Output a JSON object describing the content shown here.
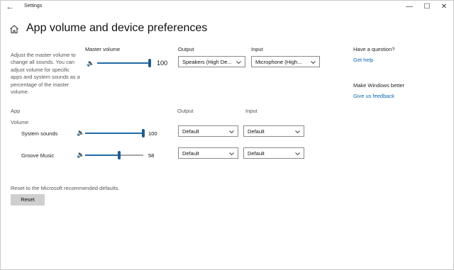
{
  "window": {
    "title": "Settings",
    "minimize_glyph": "—",
    "maximize_glyph": "☐",
    "close_glyph": "✕",
    "back_glyph": "←"
  },
  "page": {
    "title": "App volume and device preferences",
    "description": "Adjust the master volume to change all sounds. You can adjust volume for specific apps and system sounds as a percentage of the master volume."
  },
  "master": {
    "label": "Master volume",
    "value": "100",
    "level": 1.0,
    "output_label": "Output",
    "output_value": "Speakers (High De...",
    "input_label": "Input",
    "input_value": "Microphone (High..."
  },
  "apps": {
    "header": "App",
    "volume_header": "Volume",
    "output_header": "Output",
    "input_header": "Input",
    "rows": [
      {
        "name": "System sounds",
        "value": "100",
        "level": 1.0,
        "output": "Default",
        "input": "Default"
      },
      {
        "name": "Groove Music",
        "value": "58",
        "level": 0.58,
        "output": "Default",
        "input": "Default"
      }
    ]
  },
  "reset": {
    "text": "Reset to the Microsoft recommended defaults.",
    "button_label": "Reset"
  },
  "sidebar": {
    "question_heading": "Have a question?",
    "get_help": "Get help",
    "better_heading": "Make Windows better",
    "feedback": "Give us feedback"
  },
  "icons": {
    "back": "back-arrow-icon",
    "home": "home-icon",
    "speaker": "speaker-icon",
    "chevron": "chevron-down-icon"
  },
  "colors": {
    "accent": "#1f6aa5",
    "link": "#0a66b8",
    "button_bg": "#cfcfcf"
  }
}
